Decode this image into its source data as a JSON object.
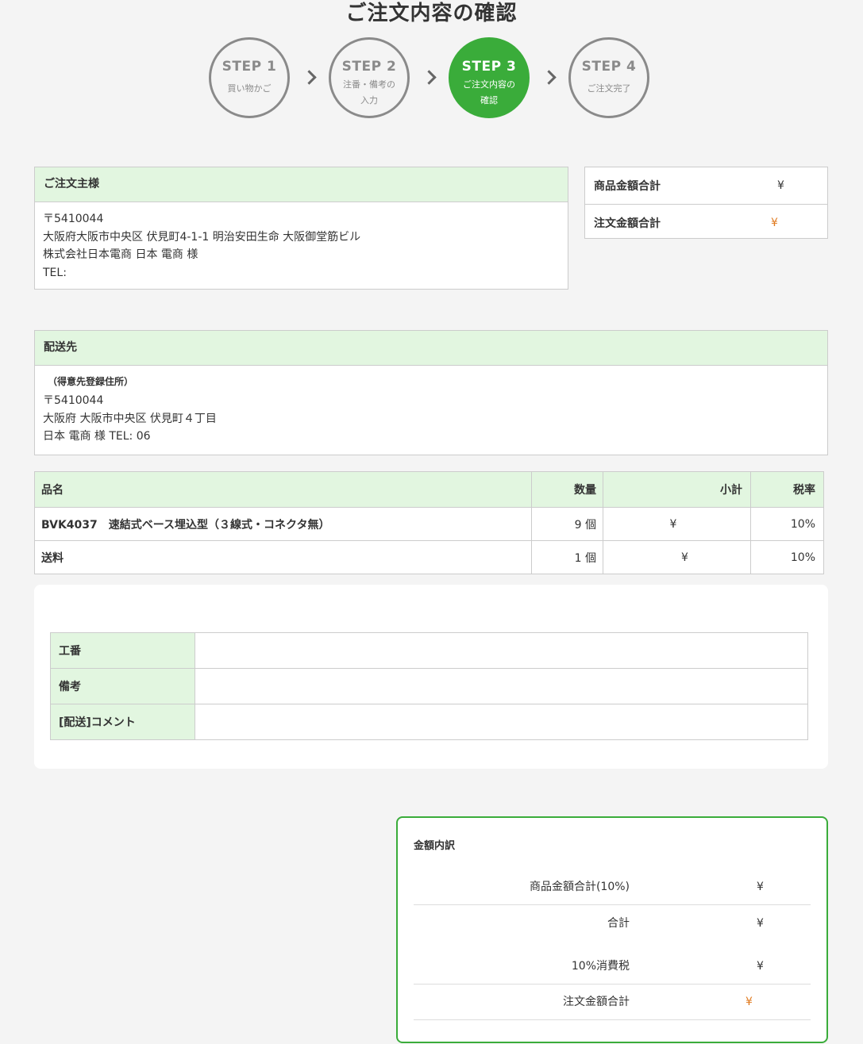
{
  "page": {
    "title": "ご注文内容の確認"
  },
  "steps": [
    {
      "num": "STEP 1",
      "label": "買い物かご",
      "label2": ""
    },
    {
      "num": "STEP 2",
      "label": "注番・備考の",
      "label2": "入力"
    },
    {
      "num": "STEP 3",
      "label": "ご注文内容の",
      "label2": "確認"
    },
    {
      "num": "STEP 4",
      "label": "ご注文完了",
      "label2": ""
    }
  ],
  "orderer": {
    "heading": "ご注文主様",
    "postal": "〒5410044",
    "address": "大阪府大阪市中央区 伏見町4-1-1 明治安田生命 大阪御堂筋ビル",
    "name": "株式会社日本電商 日本 電商 様",
    "tel": "TEL:"
  },
  "summary": {
    "product_total_label": "商品金額合計",
    "product_total_value": "¥",
    "order_total_label": "注文金額合計",
    "order_total_value": "¥"
  },
  "shipping": {
    "heading": "配送先",
    "sub": "（得意先登録住所）",
    "postal": "〒5410044",
    "address": "大阪府 大阪市中央区 伏見町４丁目",
    "name_tel": "日本 電商 様 TEL: 06"
  },
  "items": {
    "headers": {
      "name": "品名",
      "qty": "数量",
      "subtotal": "小計",
      "tax": "税率"
    },
    "rows": [
      {
        "name": "BVK4037　速結式ベース埋込型（３線式・コネクタ無）",
        "qty": "9 個",
        "subtotal": "¥",
        "tax": "10%"
      },
      {
        "name": "送料",
        "qty": "1 個",
        "subtotal": "¥",
        "tax": "10%"
      }
    ]
  },
  "notes": {
    "rows": [
      {
        "label": "工番",
        "value": ""
      },
      {
        "label": "備考",
        "value": ""
      },
      {
        "label": "[配送]コメント",
        "value": ""
      }
    ]
  },
  "breakdown": {
    "title": "金額内訳",
    "rows": [
      {
        "label": "商品金額合計(10%)",
        "value": "¥"
      },
      {
        "label": "合計",
        "value": "¥"
      },
      {
        "label": "10%消費税",
        "value": "¥"
      },
      {
        "label": "注文金額合計",
        "value": "¥"
      }
    ]
  },
  "colors": {
    "accent": "#3aac3a",
    "header_bg": "#e2f6e0",
    "price_orange": "#e07a1f"
  }
}
